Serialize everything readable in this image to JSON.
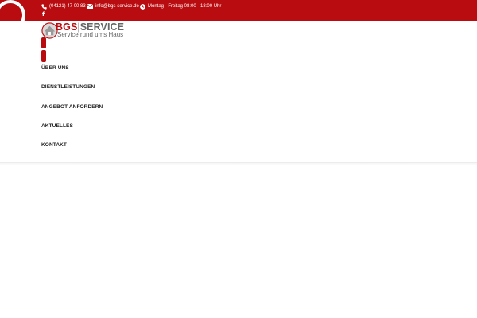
{
  "topbar": {
    "phone": "(04121) 47 00 83",
    "email": "info@bgs-service.de",
    "hours": "Montag - Freitag 08:00 - 18:00 Uhr",
    "social_icon": "f",
    "icons": [
      "phone-icon",
      "mail-icon",
      "clock-icon",
      "facebook-icon"
    ]
  },
  "logo": {
    "brand": "BGS",
    "separator": "|",
    "service": "SERVICE",
    "tagline": "Service rund ums Haus"
  },
  "nav": {
    "items": [
      {
        "label": "ÜBER UNS"
      },
      {
        "label": "DIENSTLEISTUNGEN"
      },
      {
        "label": "ANGEBOT ANFORDERN"
      },
      {
        "label": "AKTUELLES"
      },
      {
        "label": "KONTAKT"
      }
    ]
  },
  "colors": {
    "accent": "#b80c10",
    "text": "#222222",
    "background": "#ffffff"
  }
}
